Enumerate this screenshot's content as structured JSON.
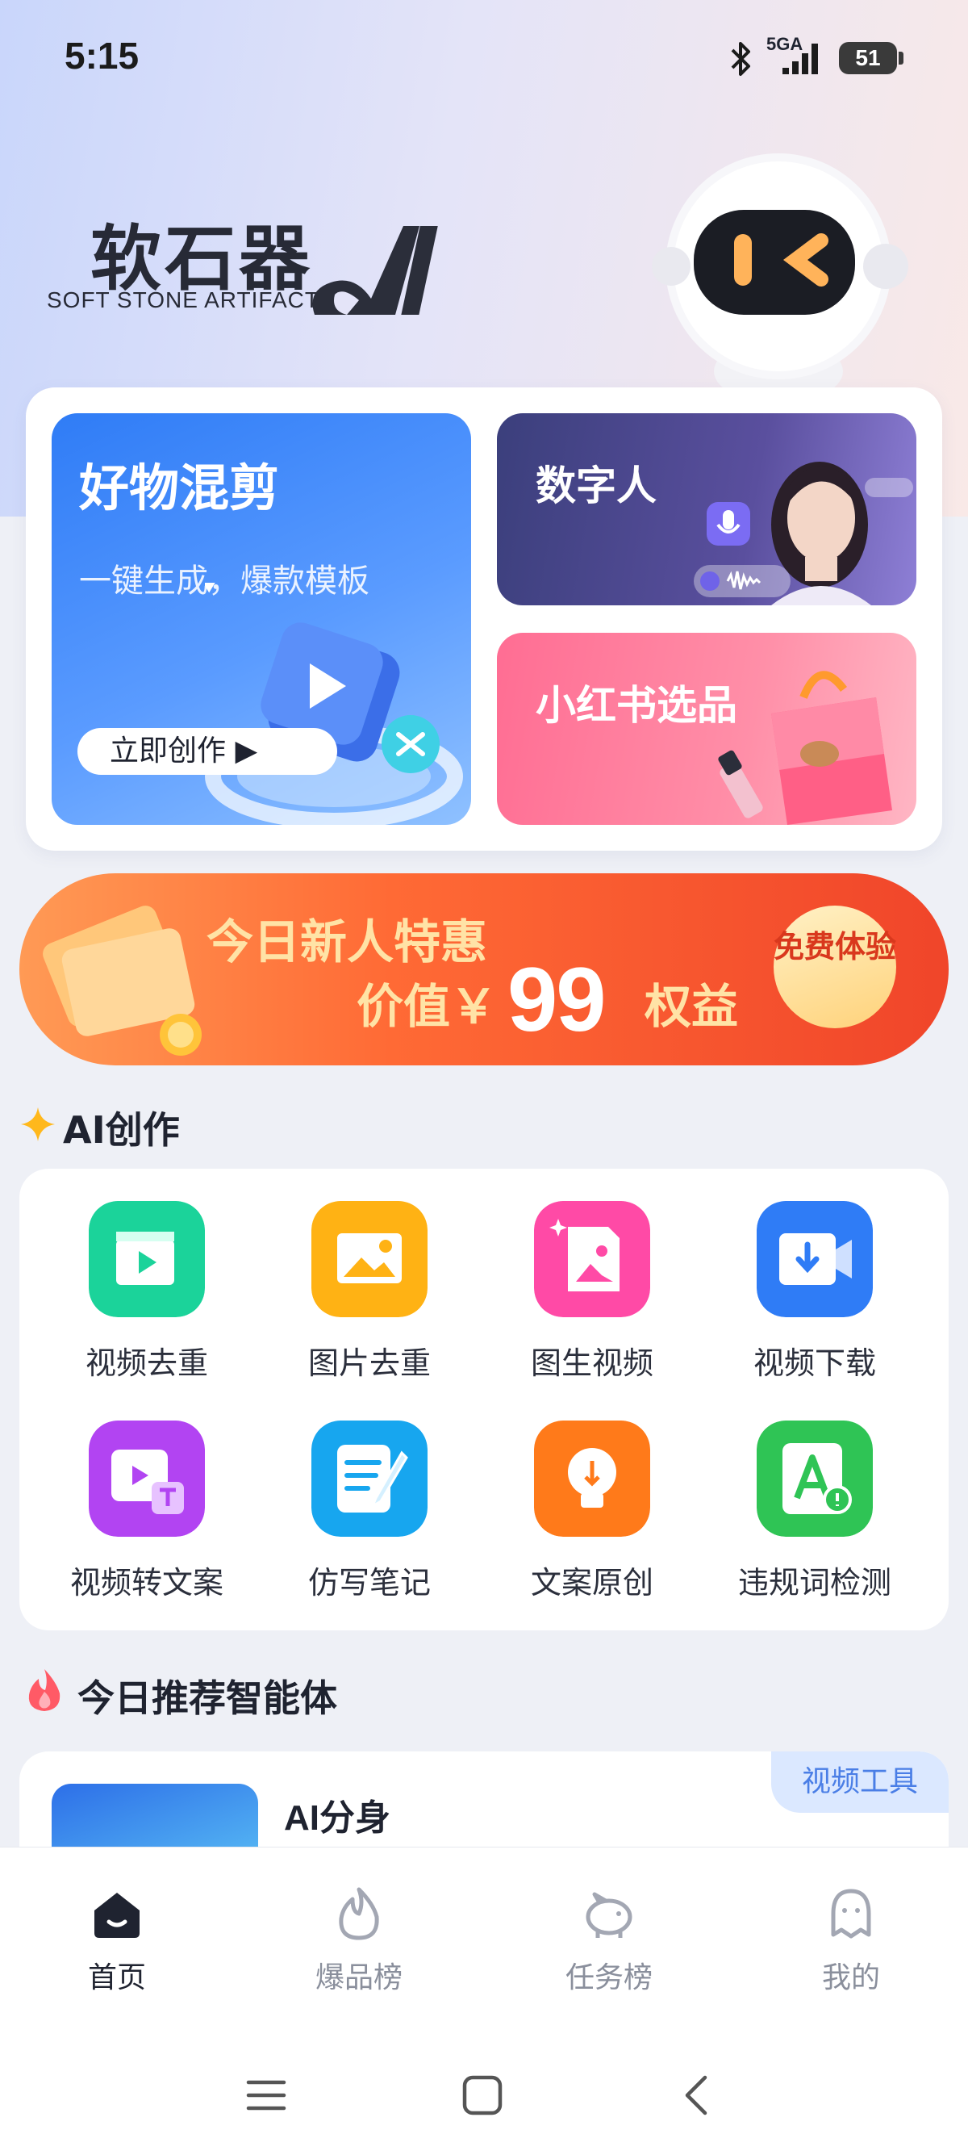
{
  "status_bar": {
    "time": "5:15",
    "network": "5GA",
    "battery": "51"
  },
  "brand": {
    "name_cn": "软石器",
    "name_en": "SOFT STONE ARTIFACT",
    "logo_mark": "AI"
  },
  "features": {
    "mix": {
      "title": "好物混剪",
      "subtitle": "一键生成，爆款模板",
      "button": "立即创作 ▶"
    },
    "digital_human": {
      "title": "数字人"
    },
    "xhs": {
      "title": "小红书选品"
    }
  },
  "promo": {
    "line1": "今日新人特惠",
    "line2_prefix": "价值￥",
    "amount": "99",
    "line2_suffix": "权益",
    "cta": "免费体验"
  },
  "ai_section": {
    "title": "AI创作",
    "tools": [
      {
        "label": "视频去重",
        "color": "#1bd39a",
        "icon": "video-clapper-icon"
      },
      {
        "label": "图片去重",
        "color": "#ffb214",
        "icon": "image-icon"
      },
      {
        "label": "图生视频",
        "color": "#ff4aa6",
        "icon": "image-to-video-icon"
      },
      {
        "label": "视频下载",
        "color": "#2f7cf6",
        "icon": "video-download-icon"
      },
      {
        "label": "视频转文案",
        "color": "#b244f2",
        "icon": "video-to-text-icon"
      },
      {
        "label": "仿写笔记",
        "color": "#17a6ef",
        "icon": "note-edit-icon"
      },
      {
        "label": "文案原创",
        "color": "#ff7a1a",
        "icon": "lightbulb-icon"
      },
      {
        "label": "违规词检测",
        "color": "#2fc455",
        "icon": "word-check-icon"
      }
    ]
  },
  "recommend": {
    "title": "今日推荐智能体",
    "item_name": "AI分身",
    "item_tag": "视频工具"
  },
  "bottom_nav": [
    {
      "label": "首页",
      "active": true
    },
    {
      "label": "爆品榜",
      "active": false
    },
    {
      "label": "任务榜",
      "active": false
    },
    {
      "label": "我的",
      "active": false
    }
  ]
}
